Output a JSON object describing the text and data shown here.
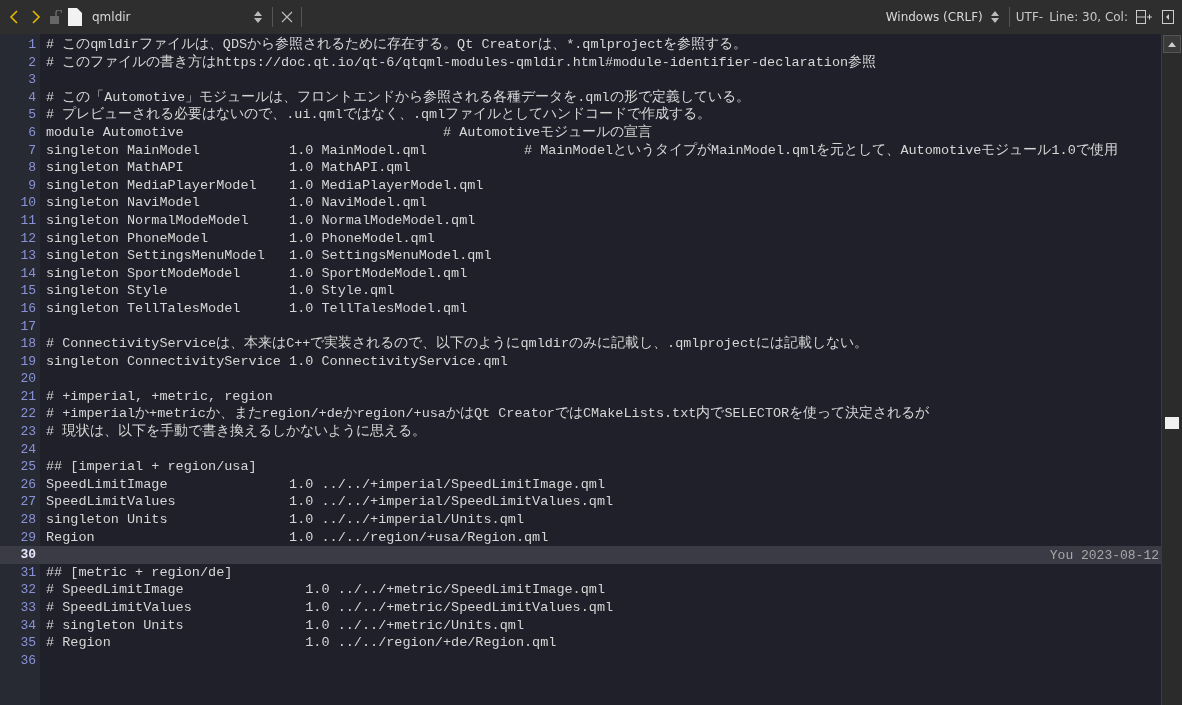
{
  "toolbar": {
    "file_name": "qmldir",
    "line_ending": "Windows (CRLF)",
    "encoding": "UTF-",
    "cursor_position": "Line: 30, Col:"
  },
  "lines": [
    {
      "number": "1",
      "text": "# このqmldirファイルは、QDSから参照されるために存在する。Qt Creatorは、*.qmlprojectを参照する。",
      "current": false
    },
    {
      "number": "2",
      "text": "# このファイルの書き方はhttps://doc.qt.io/qt-6/qtqml-modules-qmldir.html#module-identifier-declaration参照",
      "current": false
    },
    {
      "number": "3",
      "current": false
    },
    {
      "number": "4",
      "text": "# この「Automotive」モジュールは、フロントエンドから参照される各種データを.qmlの形で定義している。",
      "current": false
    },
    {
      "number": "5",
      "text": "# プレビューされる必要はないので、.ui.qmlではなく、.qmlファイルとしてハンドコードで作成する。",
      "current": false
    },
    {
      "number": "6",
      "text": "module Automotive                                # Automotiveモジュールの宣言",
      "current": false
    },
    {
      "number": "7",
      "text": "singleton MainModel           1.0 MainModel.qml            # MainModelというタイプがMainModel.qmlを元として、Automotiveモジュール1.0で使用",
      "current": false
    },
    {
      "number": "8",
      "text": "singleton MathAPI             1.0 MathAPI.qml",
      "current": false
    },
    {
      "number": "9",
      "text": "singleton MediaPlayerModel    1.0 MediaPlayerModel.qml",
      "current": false
    },
    {
      "number": "10",
      "text": "singleton NaviModel           1.0 NaviModel.qml",
      "current": false
    },
    {
      "number": "11",
      "text": "singleton NormalModeModel     1.0 NormalModeModel.qml",
      "current": false
    },
    {
      "number": "12",
      "text": "singleton PhoneModel          1.0 PhoneModel.qml",
      "current": false
    },
    {
      "number": "13",
      "text": "singleton SettingsMenuModel   1.0 SettingsMenuModel.qml",
      "current": false
    },
    {
      "number": "14",
      "text": "singleton SportModeModel      1.0 SportModeModel.qml",
      "current": false
    },
    {
      "number": "15",
      "text": "singleton Style               1.0 Style.qml",
      "current": false
    },
    {
      "number": "16",
      "text": "singleton TellTalesModel      1.0 TellTalesModel.qml",
      "current": false
    },
    {
      "number": "17",
      "current": false
    },
    {
      "number": "18",
      "text": "# ConnectivityServiceは、本来はC++で実装されるので、以下のようにqmldirのみに記載し、.qmlprojectには記載しない。",
      "current": false
    },
    {
      "number": "19",
      "text": "singleton ConnectivityService 1.0 ConnectivityService.qml",
      "current": false
    },
    {
      "number": "20",
      "current": false
    },
    {
      "number": "21",
      "text": "# +imperial, +metric, region",
      "current": false
    },
    {
      "number": "22",
      "text": "# +imperialか+metricか、またregion/+deかregion/+usaかはQt CreatorではCMakeLists.txt内でSELECTORを使って決定されるが",
      "current": false
    },
    {
      "number": "23",
      "text": "# 現状は、以下を手動で書き換えるしかないように思える。",
      "current": false
    },
    {
      "number": "24",
      "current": false
    },
    {
      "number": "25",
      "text": "## [imperial + region/usa]",
      "current": false
    },
    {
      "number": "26",
      "text": "SpeedLimitImage               1.0 ../../+imperial/SpeedLimitImage.qml",
      "current": false
    },
    {
      "number": "27",
      "text": "SpeedLimitValues              1.0 ../../+imperial/SpeedLimitValues.qml",
      "current": false
    },
    {
      "number": "28",
      "text": "singleton Units               1.0 ../../+imperial/Units.qml",
      "current": false
    },
    {
      "number": "29",
      "text": "Region                        1.0 ../../region/+usa/Region.qml",
      "current": false
    },
    {
      "number": "30",
      "current": true,
      "annotation": "You 2023-08-12"
    },
    {
      "number": "31",
      "text": "## [metric + region/de]",
      "current": false
    },
    {
      "number": "32",
      "text": "# SpeedLimitImage               1.0 ../../+metric/SpeedLimitImage.qml",
      "current": false
    },
    {
      "number": "33",
      "text": "# SpeedLimitValues              1.0 ../../+metric/SpeedLimitValues.qml",
      "current": false
    },
    {
      "number": "34",
      "text": "# singleton Units               1.0 ../../+metric/Units.qml",
      "current": false
    },
    {
      "number": "35",
      "text": "# Region                        1.0 ../../region/+de/Region.qml",
      "current": false
    },
    {
      "number": "36",
      "current": false
    }
  ]
}
